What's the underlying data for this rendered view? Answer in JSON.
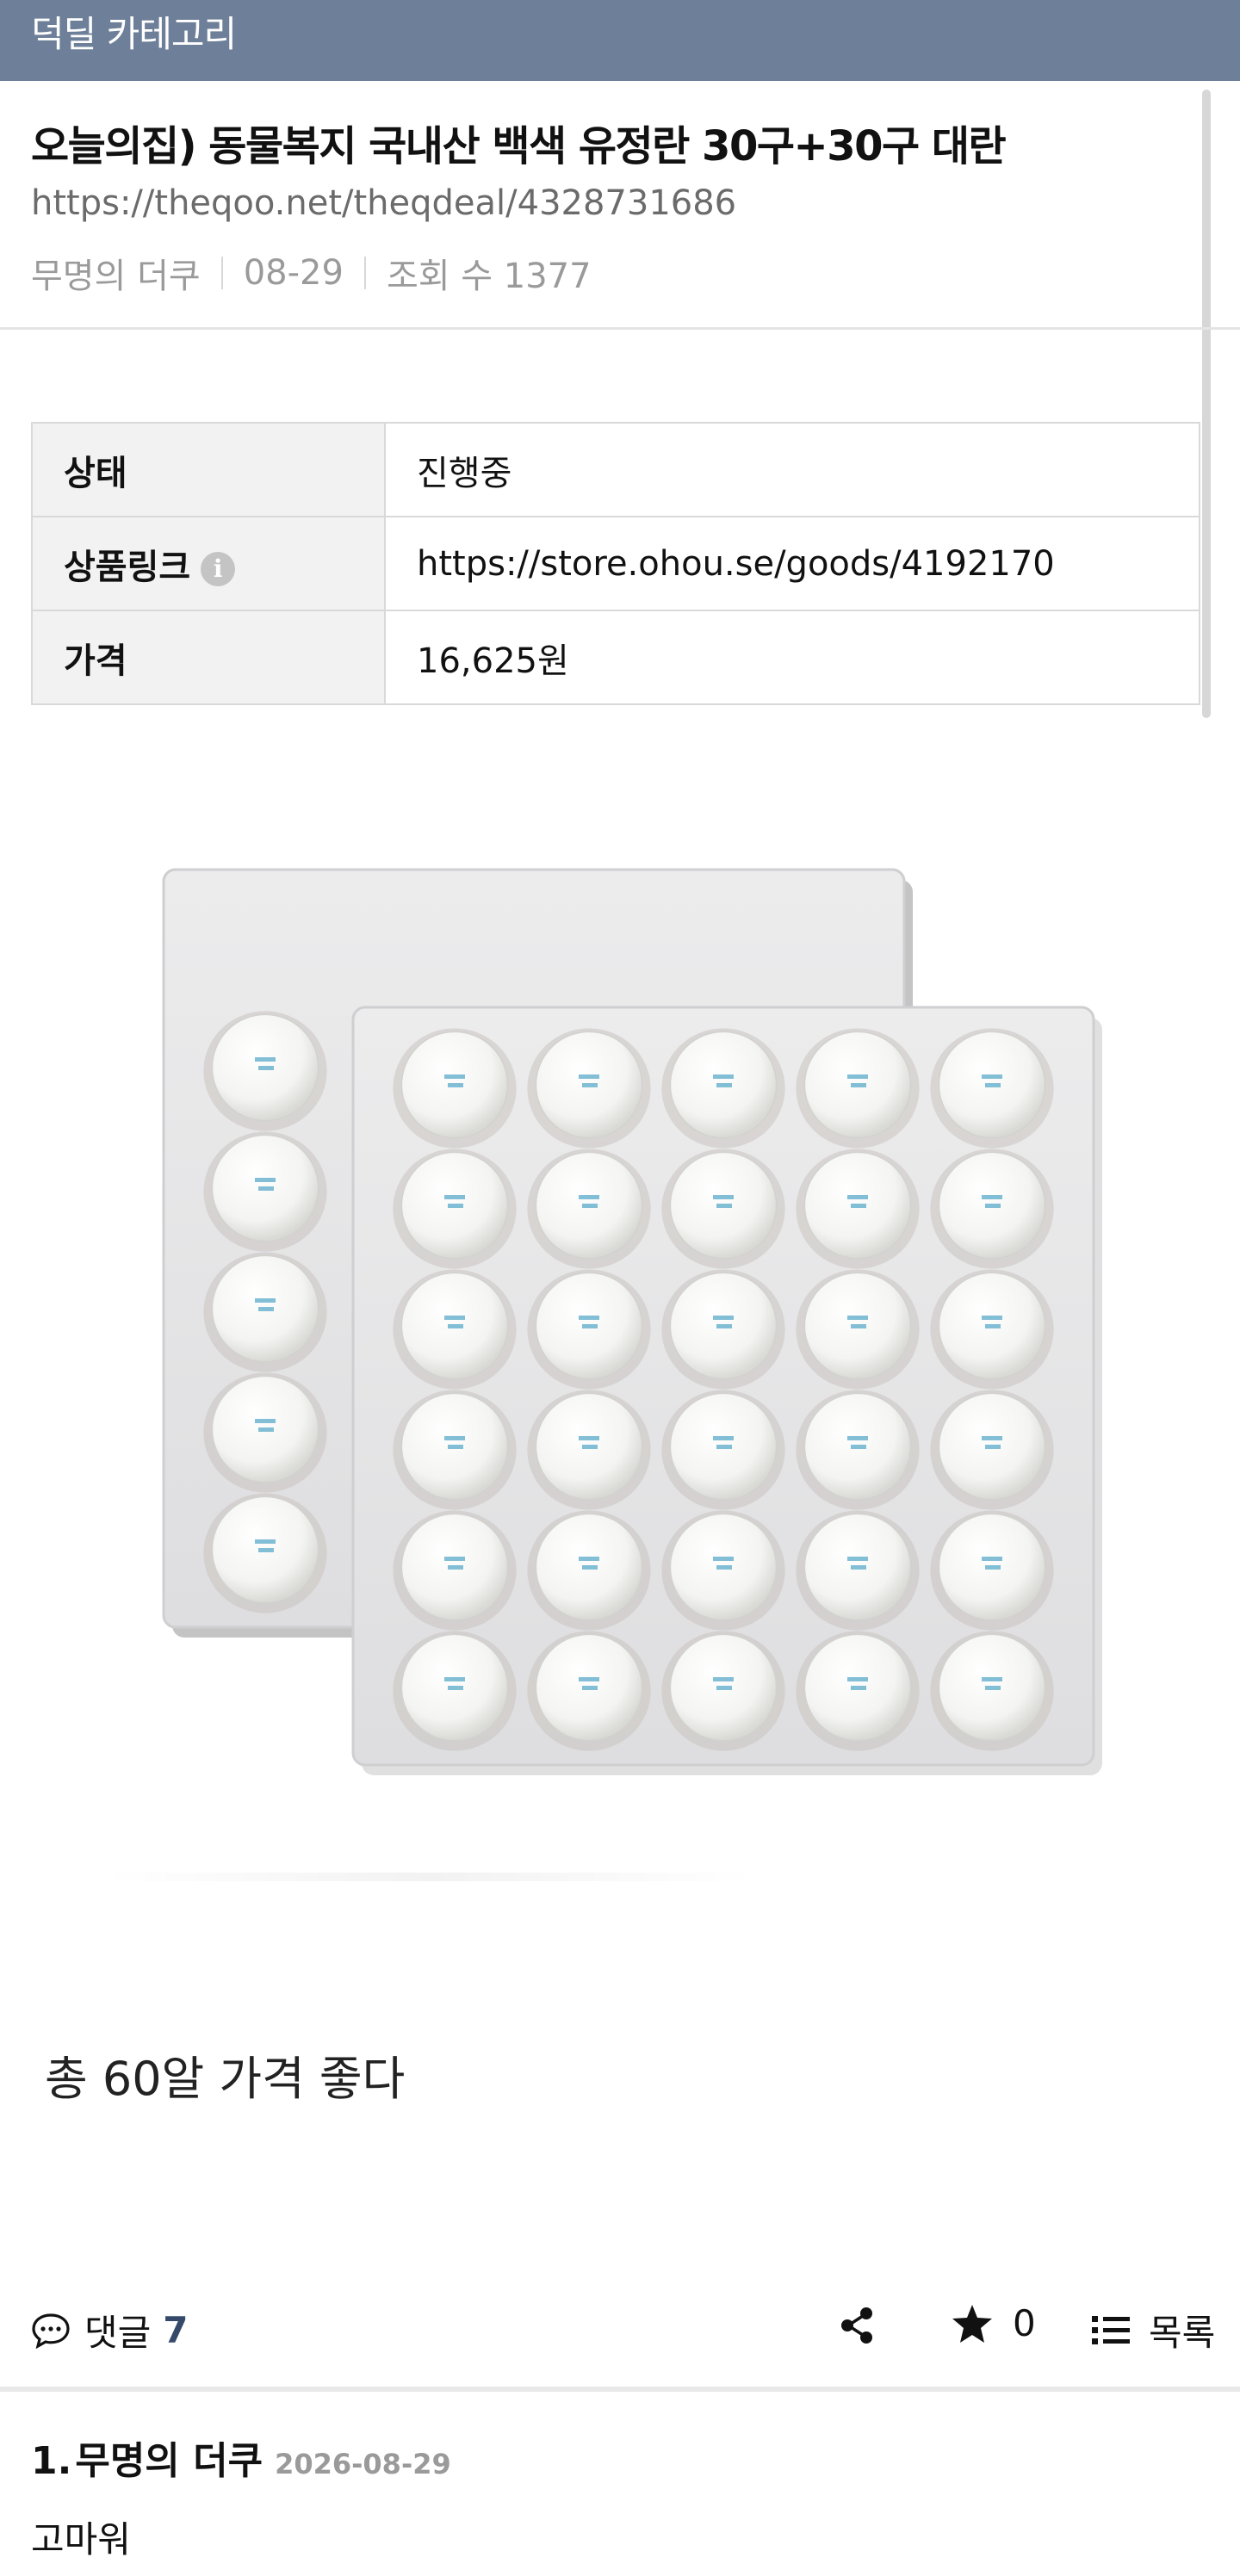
{
  "header": {
    "title": "덕딜 카테고리"
  },
  "post": {
    "title": "오늘의집) 동물복지 국내산 백색 유정란 30구+30구 대란",
    "url": "https://theqoo.net/theqdeal/4328731686",
    "author": "무명의 더쿠",
    "date": "08-29",
    "views": "조회 수 1377"
  },
  "info_table": [
    {
      "key": "상태",
      "value": "진행중"
    },
    {
      "key": "상품링크",
      "value": "https://store.ohou.se/goods/4192170",
      "icon": "info-icon"
    },
    {
      "key": "가격",
      "value": "16,625원"
    }
  ],
  "product_image": {
    "description_icon": "egg-tray-image",
    "trays": 2,
    "eggs_per_tray": 30,
    "colors": {
      "tray": "#e9e9ea",
      "egg": "#f7f7f5",
      "stamp": "#5aa9c8"
    }
  },
  "body_text": "총 60알 가격 좋다",
  "actions": {
    "comment_label": "댓글",
    "comment_count": "7",
    "share_icon": "share-icon",
    "star_count": "0",
    "list_label": "목록"
  },
  "comments": [
    {
      "index": "1.",
      "author": "무명의 더쿠",
      "date": "2026-08-29",
      "text": "고마워"
    }
  ],
  "colors": {
    "header_bg": "#6d7f99",
    "comment_count": "#354a6a",
    "meta": "#9a9a9a"
  }
}
